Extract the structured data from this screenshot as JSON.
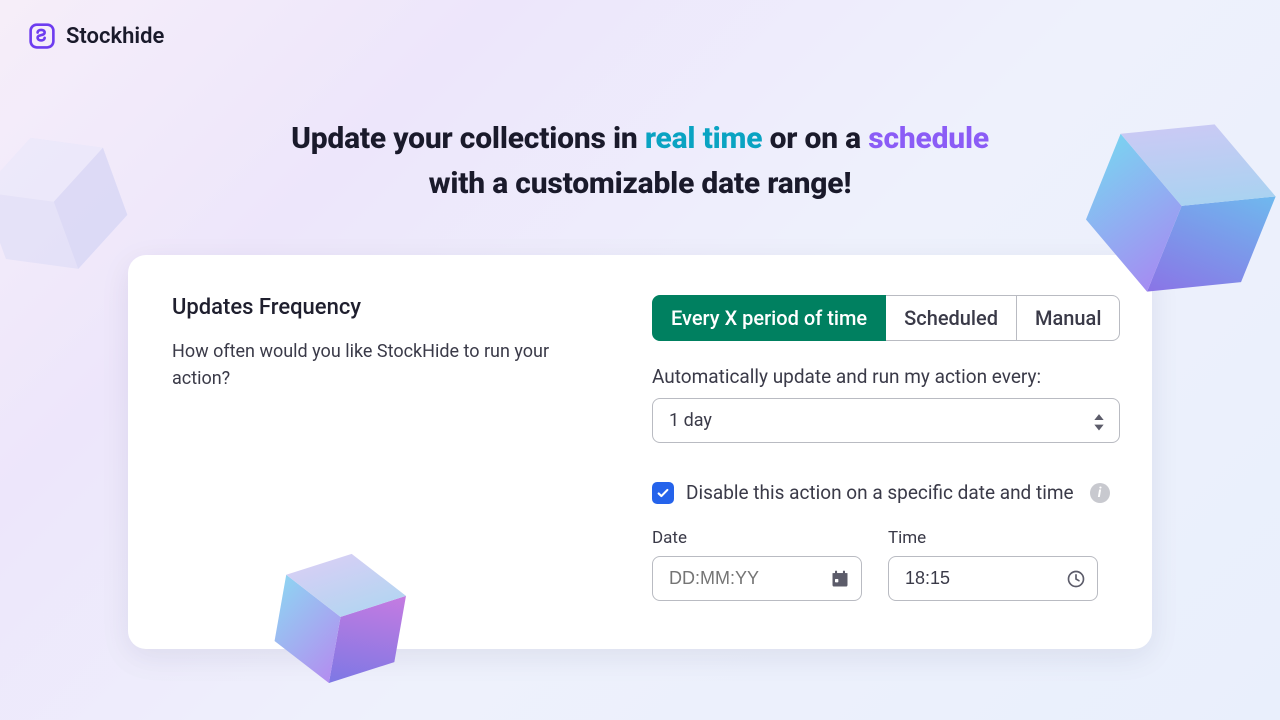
{
  "brand": {
    "name": "Stockhide"
  },
  "headline": {
    "pre": "Update your collections in ",
    "teal": "real time",
    "mid": " or on a ",
    "purple": "schedule",
    "line2": "with a customizable date range!"
  },
  "card": {
    "title": "Updates Frequency",
    "subtitle": "How often would you like StockHide to run your action?",
    "tabs": {
      "active": "Every X period of time",
      "second": "Scheduled",
      "third": "Manual"
    },
    "auto_label": "Automatically update and run my action every:",
    "interval_value": "1 day",
    "disable_label": "Disable this action on a specific date and time",
    "date_label": "Date",
    "date_placeholder": "DD:MM:YY",
    "time_label": "Time",
    "time_value": "18:15"
  },
  "colors": {
    "teal": "#0aa3c2",
    "purple": "#8b5cf6",
    "green": "#008060",
    "blue": "#2563eb"
  }
}
